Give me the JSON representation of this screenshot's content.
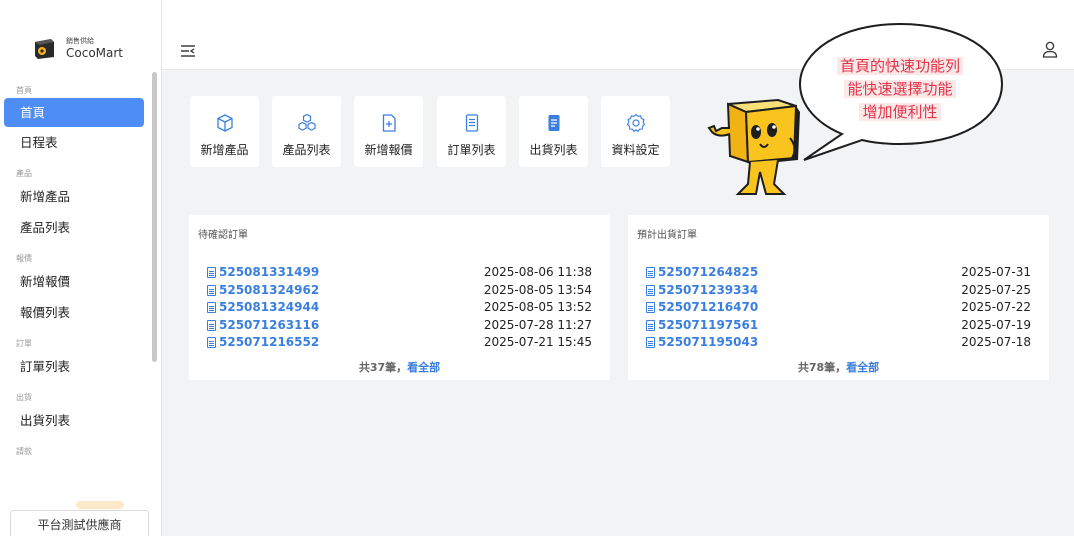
{
  "brand": {
    "subtitle": "銷售供給",
    "name": "CocoMart"
  },
  "sidebar": {
    "sections": [
      {
        "label": "首頁",
        "items": [
          {
            "label": "首頁",
            "active": true
          },
          {
            "label": "日程表"
          }
        ]
      },
      {
        "label": "產品",
        "items": [
          {
            "label": "新增產品"
          },
          {
            "label": "產品列表"
          }
        ]
      },
      {
        "label": "報價",
        "items": [
          {
            "label": "新增報價"
          },
          {
            "label": "報價列表"
          }
        ]
      },
      {
        "label": "訂單",
        "items": [
          {
            "label": "訂單列表"
          }
        ]
      },
      {
        "label": "出貨",
        "items": [
          {
            "label": "出貨列表"
          }
        ]
      },
      {
        "label": "請款",
        "items": []
      }
    ],
    "supplier_button": "平台測試供應商"
  },
  "quick_actions": [
    {
      "label": "新增產品",
      "icon": "cube-icon"
    },
    {
      "label": "產品列表",
      "icon": "cubes-icon"
    },
    {
      "label": "新增報價",
      "icon": "file-plus-icon"
    },
    {
      "label": "訂單列表",
      "icon": "document-lines-icon"
    },
    {
      "label": "出貨列表",
      "icon": "document-filled-icon"
    },
    {
      "label": "資料設定",
      "icon": "gear-icon"
    }
  ],
  "bubble": {
    "lines": [
      "首頁的快速功能列",
      "能快速選擇功能",
      "增加便利性"
    ]
  },
  "pending_orders": {
    "title": "待確認訂單",
    "rows": [
      {
        "id": "525081331499",
        "date": "2025-08-06 11:38"
      },
      {
        "id": "525081324962",
        "date": "2025-08-05 13:54"
      },
      {
        "id": "525081324944",
        "date": "2025-08-05 13:52"
      },
      {
        "id": "525071263116",
        "date": "2025-07-28 11:27"
      },
      {
        "id": "525071216552",
        "date": "2025-07-21 15:45"
      }
    ],
    "footer_count": "共37筆，",
    "footer_link": "看全部"
  },
  "expected_shipments": {
    "title": "預計出貨訂單",
    "rows": [
      {
        "id": "525071264825",
        "date": "2025-07-31"
      },
      {
        "id": "525071239334",
        "date": "2025-07-25"
      },
      {
        "id": "525071216470",
        "date": "2025-07-22"
      },
      {
        "id": "525071197561",
        "date": "2025-07-19"
      },
      {
        "id": "525071195043",
        "date": "2025-07-18"
      }
    ],
    "footer_count": "共78筆，",
    "footer_link": "看全部"
  },
  "colors": {
    "accent": "#4e8cf6",
    "link": "#3a7fe0",
    "bubble_text": "#e0344a",
    "mascot": "#f9c41e"
  }
}
